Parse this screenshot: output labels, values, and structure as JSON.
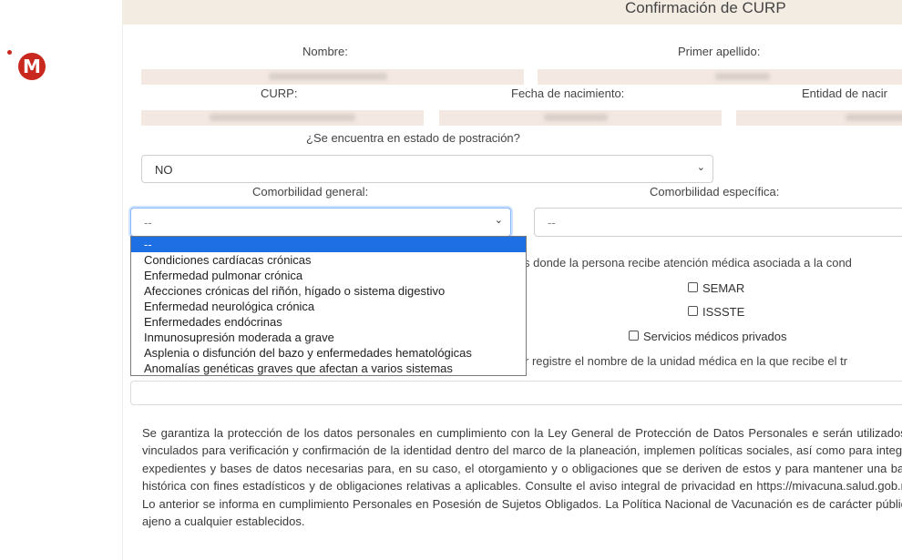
{
  "header": {
    "title": "Confirmación de CURP"
  },
  "labels": {
    "nombre": "Nombre:",
    "primer_apellido": "Primer apellido:",
    "curp": "CURP:",
    "fecha_nacimiento": "Fecha de nacimiento:",
    "entidad_nacimiento": "Entidad de nacir"
  },
  "postracion": {
    "question": "¿Se encuentra en estado de postración?",
    "value": "NO"
  },
  "comorbilidad": {
    "general_label": "Comorbilidad general:",
    "especifica_label": "Comorbilidad específica:",
    "general_value": "--",
    "especifica_value": "--",
    "options": [
      "--",
      "Condiciones cardíacas crónicas",
      "Enfermedad pulmonar crónica",
      "Afecciones crónicas del riñón, hígado o sistema digestivo",
      "Enfermedad neurológica crónica",
      "Enfermedades endócrinas",
      "Inmunosupresión moderada a grave",
      "Asplenia o disfunción del bazo y enfermedades hematológicas",
      "Anomalías genéticas graves que afectan a varios sistemas"
    ],
    "selected_index": 0
  },
  "atencion": {
    "question_partial": "s donde la persona recibe atención médica asociada a la cond",
    "options": [
      "SEMAR",
      "ISSSTE",
      "Servicios médicos privados"
    ]
  },
  "unidad": {
    "question_partial": "r registre el nombre de la unidad médica en la que recibe el tr"
  },
  "privacy": {
    "text": "Se garantiza la protección de los datos personales en cumplimiento con la Ley General de Protección de Datos Personales e serán utilizados y vinculados para verificación y confirmación de la identidad dentro del marco de la planeación, implemen políticas sociales, así como para integrar expedientes y bases de datos necesarias para, en su caso, el otorgamiento y o obligaciones que se deriven de estos y para mantener una base histórica con fines estadísticos y de obligaciones relativas a aplicables. Consulte el aviso integral de privacidad en https://mivacuna.salud.gob.mx Lo anterior se informa en cumplimiento Personales en Posesión de Sujetos Obligados. La Política Nacional de Vacunación es de carácter público, ajeno a cualquier establecidos."
  },
  "logo": {
    "letter": "M",
    "color": "#c8281e"
  }
}
